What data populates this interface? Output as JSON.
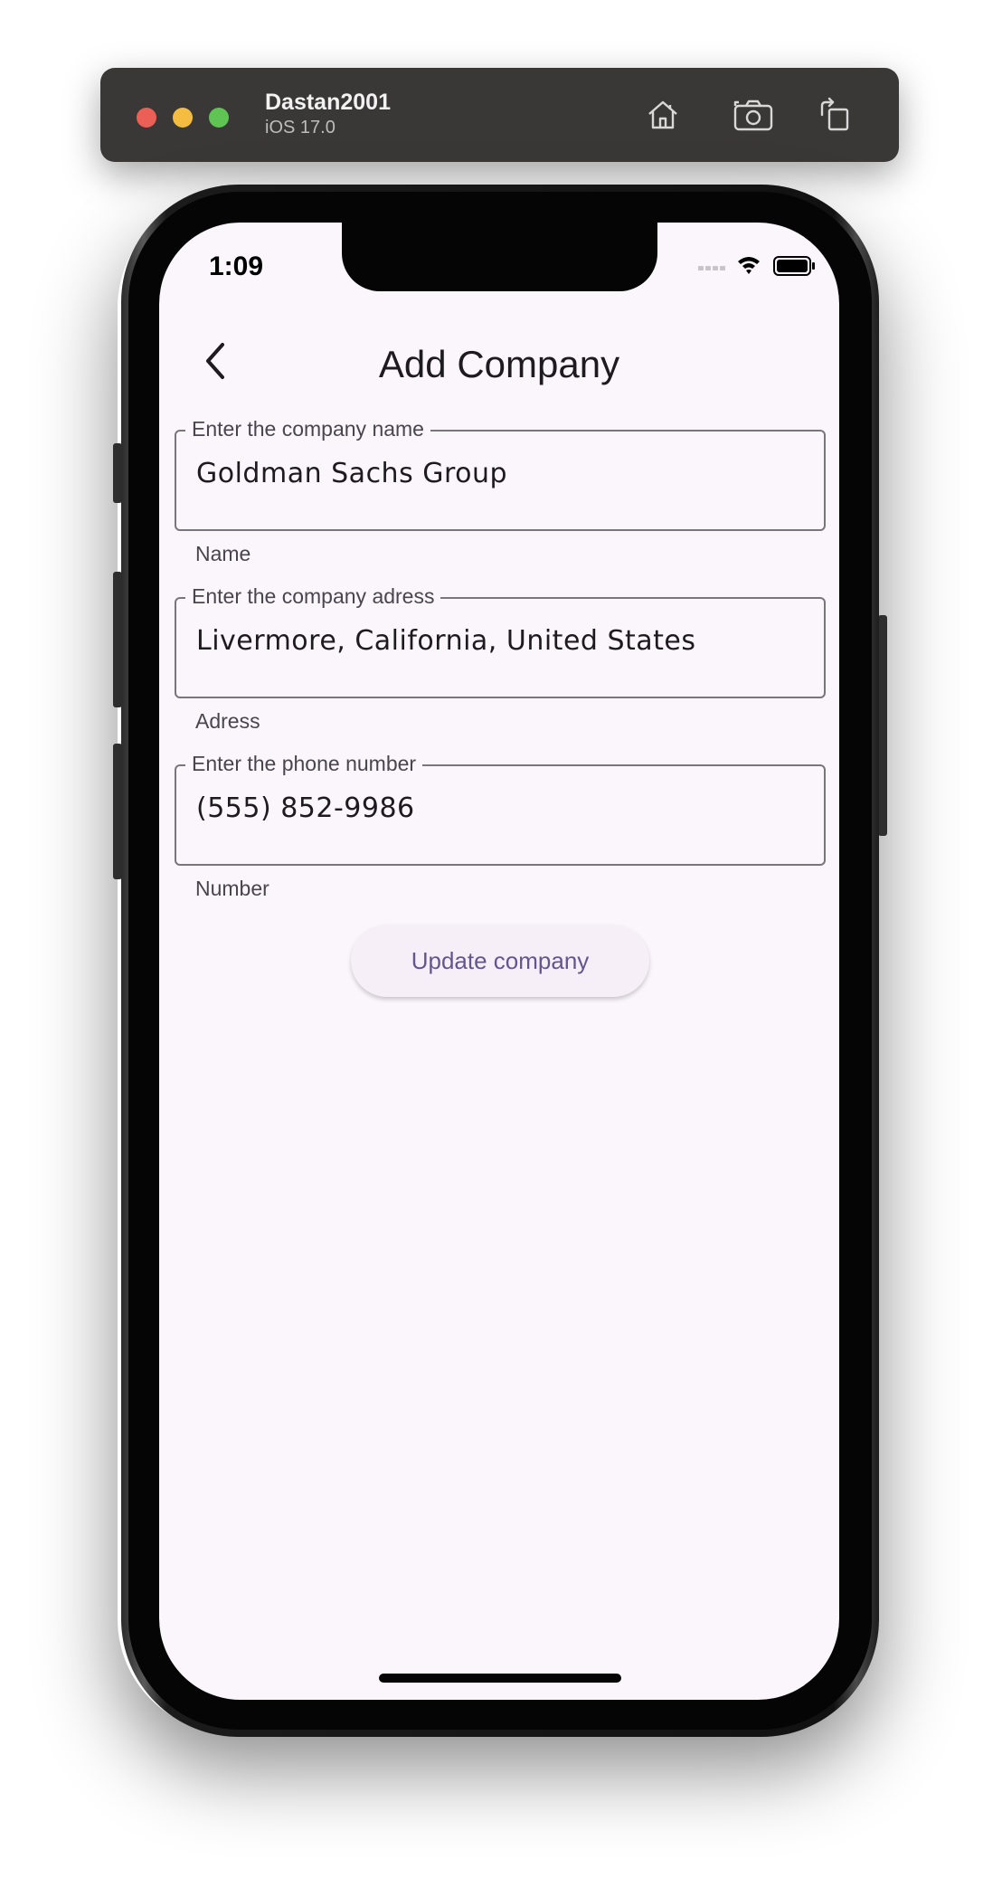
{
  "simulator": {
    "device_name": "Dastan2001",
    "os_version": "iOS 17.0",
    "toolbar_icons": [
      "home-icon",
      "screenshot-icon",
      "rotate-icon"
    ]
  },
  "status_bar": {
    "time": "1:09",
    "icons": [
      "cellular-signal-icon",
      "wifi-icon",
      "battery-icon"
    ]
  },
  "app_bar": {
    "back_icon": "chevron-left-icon",
    "title": "Add Company"
  },
  "form": {
    "fields": [
      {
        "label": "Enter the company name",
        "value": "Goldman Sachs Group",
        "helper": "Name"
      },
      {
        "label": "Enter the company adress",
        "value": "Livermore, California, United States",
        "helper": "Adress"
      },
      {
        "label": "Enter the phone number",
        "value": "(555) 852-9986",
        "helper": "Number"
      }
    ],
    "submit_label": "Update company"
  },
  "colors": {
    "screen_background": "#fbf5fc",
    "field_border": "#79747e",
    "button_text": "#65558f",
    "button_background": "#f6eff8"
  }
}
